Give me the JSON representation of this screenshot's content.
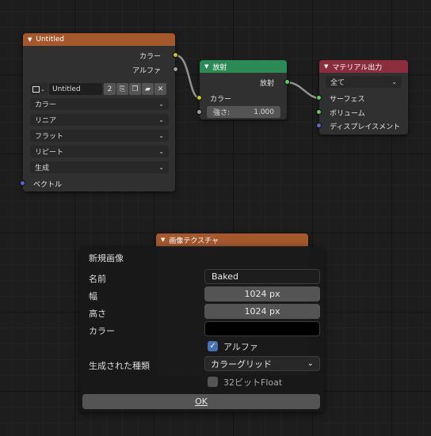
{
  "colors": {
    "image_header": "#a5582c",
    "emission_header": "#2b8a55",
    "output_header": "#8b2d3c",
    "link": "#909090"
  },
  "image_node": {
    "title": "Untitled",
    "out_color": "カラー",
    "out_alpha": "アルファ",
    "image_name": "Untitled",
    "users": "2",
    "dropdowns": [
      "カラー",
      "リニア",
      "フラット",
      "リピート",
      "生成"
    ],
    "in_vector": "ベクトル"
  },
  "emission_node": {
    "title": "放射",
    "out_emission": "放射",
    "in_color": "カラー",
    "strength_label": "強さ:",
    "strength_value": "1.000"
  },
  "output_node": {
    "title": "マテリアル出力",
    "target": "全て",
    "in_surface": "サーフェス",
    "in_volume": "ボリューム",
    "in_displacement": "ディスプレイスメント"
  },
  "tex_node": {
    "title": "画像テクスチャ"
  },
  "dialog": {
    "title": "新規画像",
    "name_label": "名前",
    "name_value": "Baked",
    "width_label": "幅",
    "width_value": "1024 px",
    "height_label": "高さ",
    "height_value": "1024 px",
    "color_label": "カラー",
    "color_value": "#000000",
    "alpha_label": "アルファ",
    "alpha_checked": true,
    "gen_type_label": "生成された種類",
    "gen_type_value": "カラーグリッド",
    "float_label": "32ビットFloat",
    "float_checked": false,
    "ok_label": "OK"
  }
}
